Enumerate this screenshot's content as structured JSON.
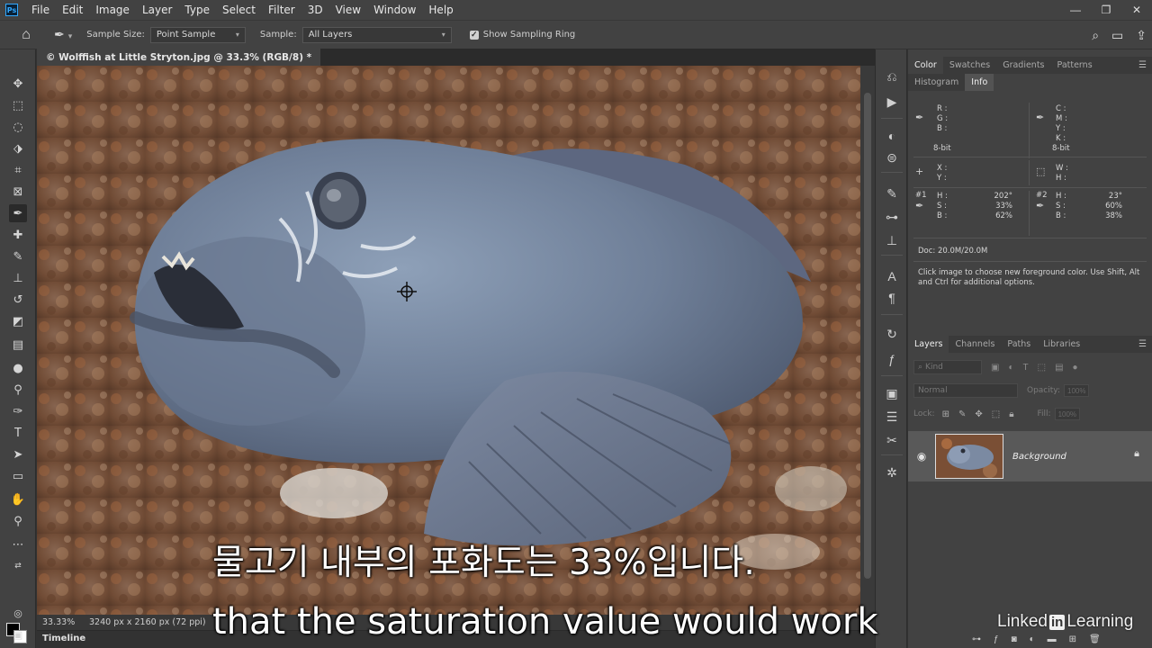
{
  "app": {
    "logo_text": "Ps"
  },
  "menu": [
    "File",
    "Edit",
    "Image",
    "Layer",
    "Type",
    "Select",
    "Filter",
    "3D",
    "View",
    "Window",
    "Help"
  ],
  "window_controls": {
    "minimize": "—",
    "restore": "❐",
    "close": "✕"
  },
  "options": {
    "sample_size_label": "Sample Size:",
    "sample_size_value": "Point Sample",
    "sample_label": "Sample:",
    "sample_value": "All Layers",
    "show_sampling_ring_label": "Show Sampling Ring",
    "show_sampling_ring_checked": true
  },
  "document": {
    "tab_title": "© Wolffish at Little Stryton.jpg @ 33.3% (RGB/8) *",
    "zoom": "33.33%",
    "dimensions": "3240 px x 2160 px (72 ppi)"
  },
  "timeline_label": "Timeline",
  "panels": {
    "top_tabs": [
      "Color",
      "Swatches",
      "Gradients",
      "Patterns"
    ],
    "second_tabs": [
      "Histogram",
      "Info"
    ],
    "info": {
      "rgb_labels": [
        "R :",
        "G :",
        "B :"
      ],
      "rgb_bit": "8-bit",
      "cmyk_labels": [
        "C :",
        "M :",
        "Y :",
        "K :"
      ],
      "cmyk_bit": "8-bit",
      "xy_labels": [
        "X :",
        "Y :"
      ],
      "wh_labels": [
        "W :",
        "H :"
      ],
      "sample1_tag": "#1",
      "sample2_tag": "#2",
      "hsb_labels": [
        "H :",
        "S :",
        "B :"
      ],
      "sample1_values": [
        "202°",
        "33%",
        "62%"
      ],
      "sample2_values": [
        "23°",
        "60%",
        "38%"
      ],
      "doc": "Doc: 20.0M/20.0M",
      "hint": "Click image to choose new foreground color.  Use Shift, Alt and Ctrl for additional options."
    },
    "layers_tabs": [
      "Layers",
      "Channels",
      "Paths",
      "Libraries"
    ],
    "layers": {
      "search_placeholder": "Kind",
      "blend_mode": "Normal",
      "opacity_label": "Opacity:",
      "opacity_value": "100%",
      "lock_label": "Lock:",
      "fill_label": "Fill:",
      "fill_value": "100%",
      "layer_name": "Background"
    }
  },
  "subtitles": {
    "korean": "물고기 내부의 포화도는 33%입니다.",
    "english": "that the saturation value would work"
  },
  "brand": {
    "pre": "Linked",
    "mid": "in",
    "post": " Learning"
  }
}
